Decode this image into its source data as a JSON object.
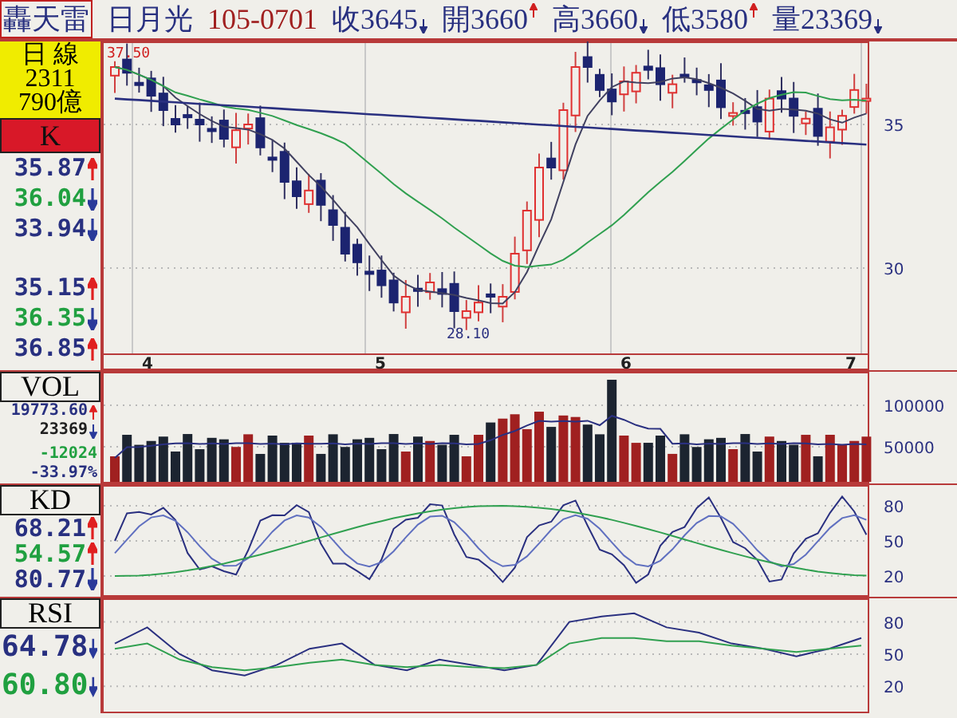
{
  "header": {
    "name": "轟天雷",
    "stock": "日月光",
    "date": "105-0701",
    "quotes": [
      {
        "text": "收3645",
        "rising": false
      },
      {
        "text": "開3660",
        "rising": true
      },
      {
        "text": "高3660",
        "rising": false
      },
      {
        "text": "低3580",
        "rising": true
      },
      {
        "text": "量23369",
        "rising": false
      }
    ]
  },
  "info": {
    "period": "日 線",
    "code": "2311",
    "amount": "790億"
  },
  "panels": [
    {
      "kind": "price",
      "title": "K",
      "readings": [
        {
          "value": "35.87",
          "color": "#283080",
          "rising": true
        },
        {
          "value": "36.04",
          "color": "#20a040",
          "rising": false
        },
        {
          "value": "33.94",
          "color": "#283080",
          "rising": false
        },
        {
          "value": "35.15",
          "color": "#283080",
          "rising": true
        },
        {
          "value": "36.35",
          "color": "#20a040",
          "rising": false
        },
        {
          "value": "36.85",
          "color": "#283080",
          "rising": true
        }
      ],
      "axis_labels": [
        "35",
        "30"
      ],
      "high_label": "37.50",
      "low_label": "28.10",
      "months": [
        "4",
        "5",
        "6",
        "7"
      ]
    },
    {
      "kind": "volume",
      "title": "VOL",
      "readings": [
        {
          "value": "19773.60",
          "color": "#283080",
          "rising": true
        },
        {
          "value": "23369",
          "color": "#202020",
          "rising": false
        },
        {
          "value": "-12024",
          "color": "#20a040"
        },
        {
          "value": "-33.97%",
          "color": "#283080"
        }
      ],
      "axis_labels": [
        "100000",
        "50000"
      ]
    },
    {
      "kind": "kd",
      "title": "KD",
      "readings": [
        {
          "value": "68.21",
          "color": "#283080",
          "rising": true
        },
        {
          "value": "54.57",
          "color": "#20a040",
          "rising": true
        },
        {
          "value": "80.77",
          "color": "#283080",
          "rising": false
        }
      ],
      "axis_labels": [
        "80",
        "50",
        "20"
      ]
    },
    {
      "kind": "rsi",
      "title": "RSI",
      "readings": [
        {
          "value": "64.78",
          "color": "#283080",
          "rising": false
        },
        {
          "value": "60.80",
          "color": "#20a040",
          "rising": false
        }
      ],
      "chart_data": {
        "type": "line",
        "yticks": [
          80,
          50,
          20
        ],
        "ylim": [
          -5,
          102
        ],
        "grid": true,
        "series": [
          {
            "color": "#2a3080",
            "values": [
              60,
              75,
              50,
              35,
              30,
              40,
              55,
              60,
              40,
              35,
              45,
              40,
              35,
              40,
              80,
              85,
              88,
              75,
              70,
              60,
              55,
              48,
              55,
              65
            ]
          },
          {
            "color": "#30a050",
            "values": [
              55,
              60,
              45,
              38,
              35,
              38,
              42,
              45,
              40,
              38,
              40,
              38,
              37,
              40,
              60,
              65,
              65,
              62,
              62,
              58,
              55,
              52,
              55,
              58
            ]
          }
        ]
      }
    }
  ]
}
